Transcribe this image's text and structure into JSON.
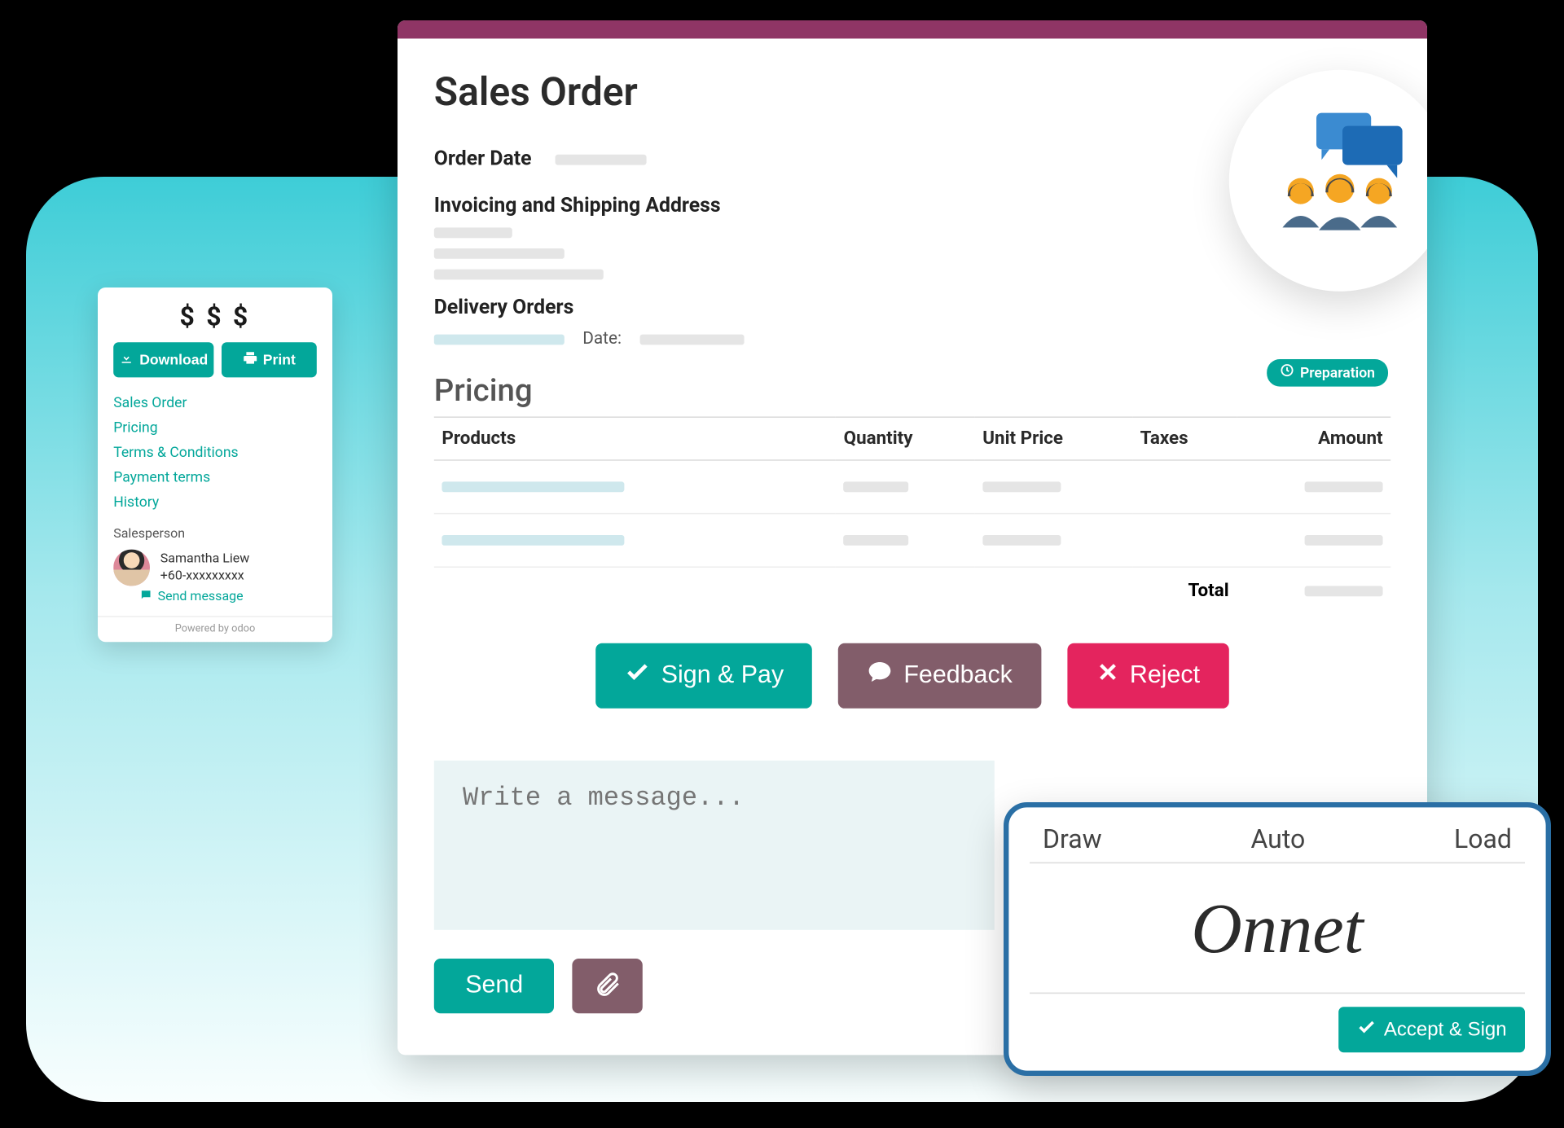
{
  "sidebar": {
    "price_header": "$ $ $",
    "download_label": "Download",
    "print_label": "Print",
    "links": [
      "Sales Order",
      "Pricing",
      "Terms & Conditions",
      "Payment terms",
      "History"
    ],
    "salesperson_label": "Salesperson",
    "salesperson_name": "Samantha Liew",
    "salesperson_phone": "+60-xxxxxxxxx",
    "send_message": "Send message",
    "powered_by": "Powered by odoo"
  },
  "order": {
    "title": "Sales Order",
    "order_date_label": "Order Date",
    "address_label": "Invoicing and Shipping Address",
    "delivery_label": "Delivery Orders",
    "delivery_date_label": "Date:",
    "status": "Preparation",
    "pricing_heading": "Pricing",
    "columns": {
      "products": "Products",
      "quantity": "Quantity",
      "unit_price": "Unit Price",
      "taxes": "Taxes",
      "amount": "Amount"
    },
    "total_label": "Total",
    "actions": {
      "sign_pay": "Sign & Pay",
      "feedback": "Feedback",
      "reject": "Reject"
    }
  },
  "compose": {
    "placeholder": "Write a message...",
    "send_label": "Send"
  },
  "signature": {
    "tabs": {
      "draw": "Draw",
      "auto": "Auto",
      "load": "Load"
    },
    "text": "Onnet",
    "accept_label": "Accept & Sign"
  }
}
